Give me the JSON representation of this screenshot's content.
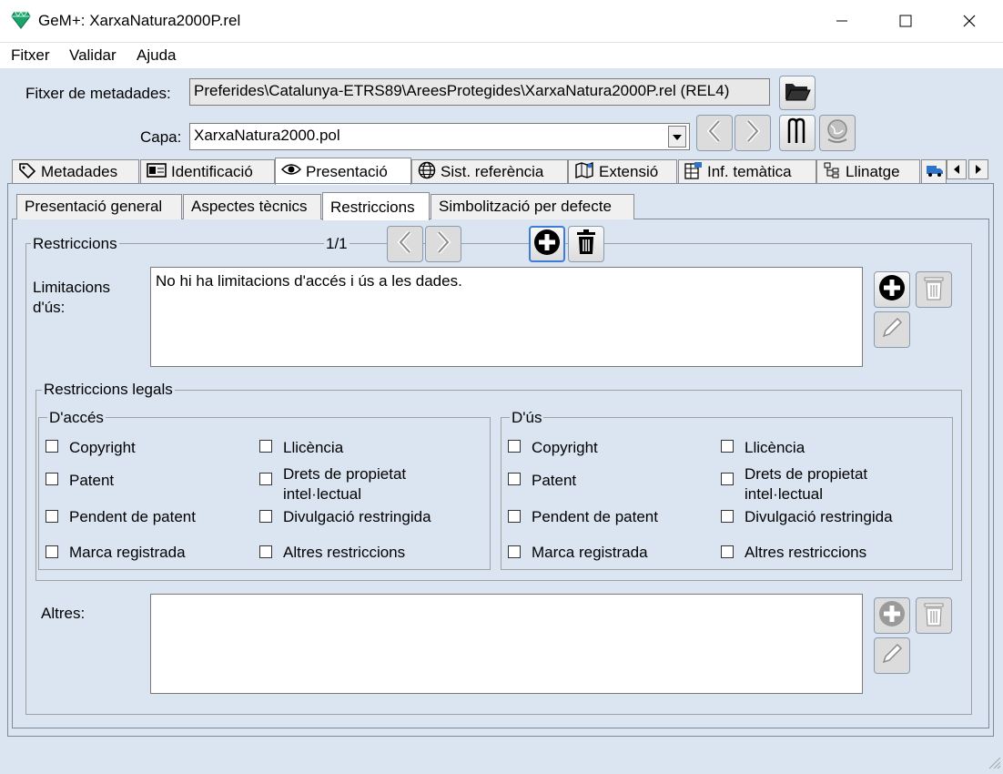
{
  "window": {
    "title": "GeM+: XarxaNatura2000P.rel"
  },
  "menu": [
    "Fitxer",
    "Validar",
    "Ajuda"
  ],
  "metadata_file": {
    "label": "Fitxer de metadades:",
    "value": "Preferides\\Catalunya-ETRS89\\AreesProtegides\\XarxaNatura2000P.rel (REL4)"
  },
  "layer": {
    "label": "Capa:",
    "value": "XarxaNatura2000.pol"
  },
  "tabs": [
    {
      "label": "Metadades",
      "icon": "tag-icon"
    },
    {
      "label": "Identificació",
      "icon": "id-card-icon"
    },
    {
      "label": "Presentació",
      "icon": "eye-icon"
    },
    {
      "label": "Sist. referència",
      "icon": "globe-icon"
    },
    {
      "label": "Extensió",
      "icon": "map-icon"
    },
    {
      "label": "Inf. temàtica",
      "icon": "table-icon"
    },
    {
      "label": "Llinatge",
      "icon": "tree-icon"
    }
  ],
  "subtabs": [
    "Presentació general",
    "Aspectes tècnics",
    "Restriccions",
    "Simbolització per defecte"
  ],
  "restrictions": {
    "group_label": "Restriccions",
    "counter": "1/1",
    "usage_limits_label": "Limitacions d'ús:",
    "usage_limits_value": "No hi ha limitacions d'accés i ús a les dades.",
    "legal_label": "Restriccions legals",
    "access_label": "D'accés",
    "use_label": "D'ús",
    "options_left": [
      "Copyright",
      "Patent",
      "Pendent de patent",
      "Marca registrada"
    ],
    "options_right": [
      "Llicència",
      "Drets de propietat intel·lectual",
      "Divulgació restringida",
      "Altres restriccions"
    ],
    "others_label": "Altres:",
    "others_value": ""
  }
}
